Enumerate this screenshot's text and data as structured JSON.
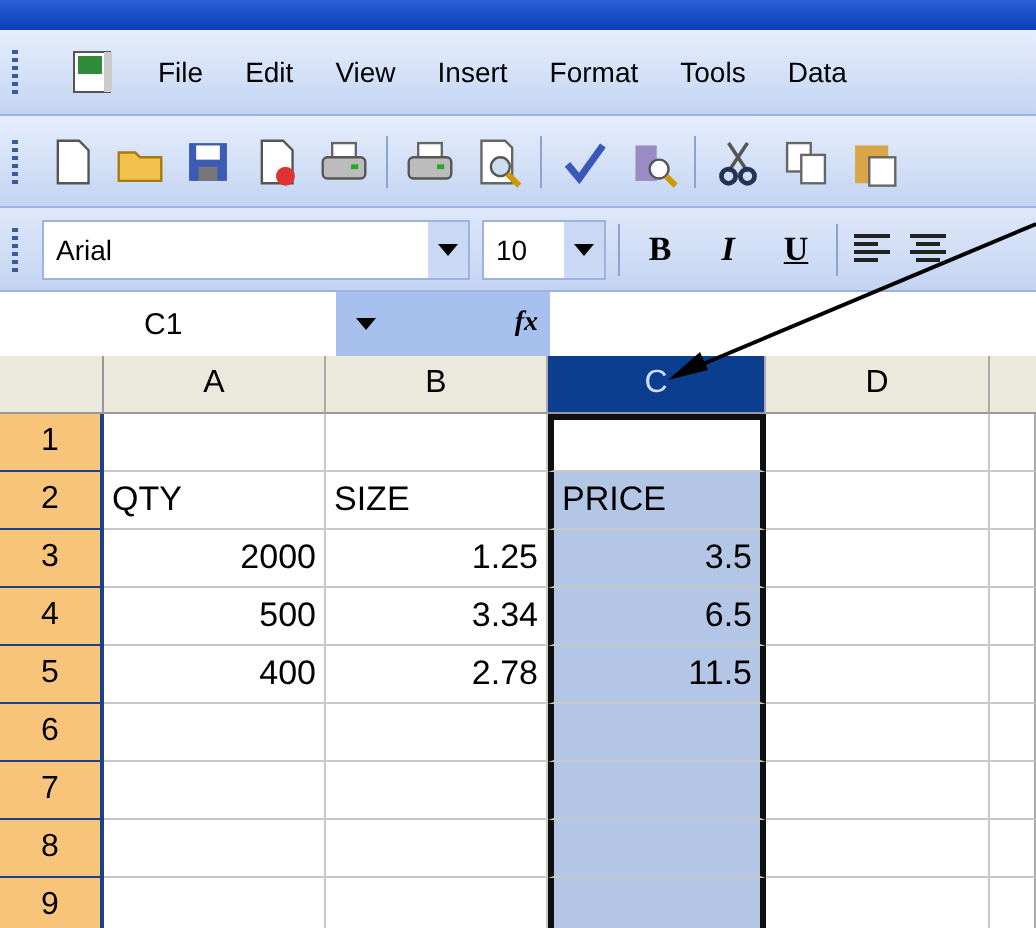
{
  "menu_bar": {
    "items": [
      {
        "label": "File"
      },
      {
        "label": "Edit"
      },
      {
        "label": "View"
      },
      {
        "label": "Insert"
      },
      {
        "label": "Format"
      },
      {
        "label": "Tools"
      },
      {
        "label": "Data"
      }
    ]
  },
  "formatting_toolbar": {
    "font": "Arial",
    "size": "10",
    "buttons": [
      {
        "label": "B",
        "kind": "bold"
      },
      {
        "label": "I",
        "kind": "italic"
      },
      {
        "label": "U",
        "kind": "underline"
      }
    ]
  },
  "formula_bar": {
    "name_box": "C1",
    "fx": "fx"
  },
  "sheet": {
    "columns": [
      {
        "label": "A",
        "selected": false
      },
      {
        "label": "B",
        "selected": false
      },
      {
        "label": "C",
        "selected": true
      },
      {
        "label": "D",
        "selected": false
      }
    ],
    "rows": [
      {
        "label": "1",
        "cells": [
          {
            "text": "",
            "active": false
          },
          {
            "text": "",
            "active": false
          },
          {
            "text": "",
            "active": true
          },
          {
            "text": "",
            "active": false
          }
        ]
      },
      {
        "label": "2",
        "cells": [
          {
            "text": "QTY",
            "active": false
          },
          {
            "text": "SIZE",
            "active": false
          },
          {
            "text": "PRICE",
            "active": false
          },
          {
            "text": "",
            "active": false
          }
        ]
      },
      {
        "label": "3",
        "cells": [
          {
            "text": "2000",
            "active": false
          },
          {
            "text": "1.25",
            "active": false
          },
          {
            "text": "3.5",
            "active": false
          },
          {
            "text": "",
            "active": false
          }
        ]
      },
      {
        "label": "4",
        "cells": [
          {
            "text": "500",
            "active": false
          },
          {
            "text": "3.34",
            "active": false
          },
          {
            "text": "6.5",
            "active": false
          },
          {
            "text": "",
            "active": false
          }
        ]
      },
      {
        "label": "5",
        "cells": [
          {
            "text": "400",
            "active": false
          },
          {
            "text": "2.78",
            "active": false
          },
          {
            "text": "11.5",
            "active": false
          },
          {
            "text": "",
            "active": false
          }
        ]
      },
      {
        "label": "6",
        "cells": [
          {
            "text": "",
            "active": false
          },
          {
            "text": "",
            "active": false
          },
          {
            "text": "",
            "active": false
          },
          {
            "text": "",
            "active": false
          }
        ]
      },
      {
        "label": "7",
        "cells": [
          {
            "text": "",
            "active": false
          },
          {
            "text": "",
            "active": false
          },
          {
            "text": "",
            "active": false
          },
          {
            "text": "",
            "active": false
          }
        ]
      },
      {
        "label": "8",
        "cells": [
          {
            "text": "",
            "active": false
          },
          {
            "text": "",
            "active": false
          },
          {
            "text": "",
            "active": false
          },
          {
            "text": "",
            "active": false
          }
        ]
      },
      {
        "label": "9",
        "cells": [
          {
            "text": "",
            "active": false
          },
          {
            "text": "",
            "active": false
          },
          {
            "text": "",
            "active": false
          },
          {
            "text": "",
            "active": false
          }
        ]
      }
    ]
  }
}
